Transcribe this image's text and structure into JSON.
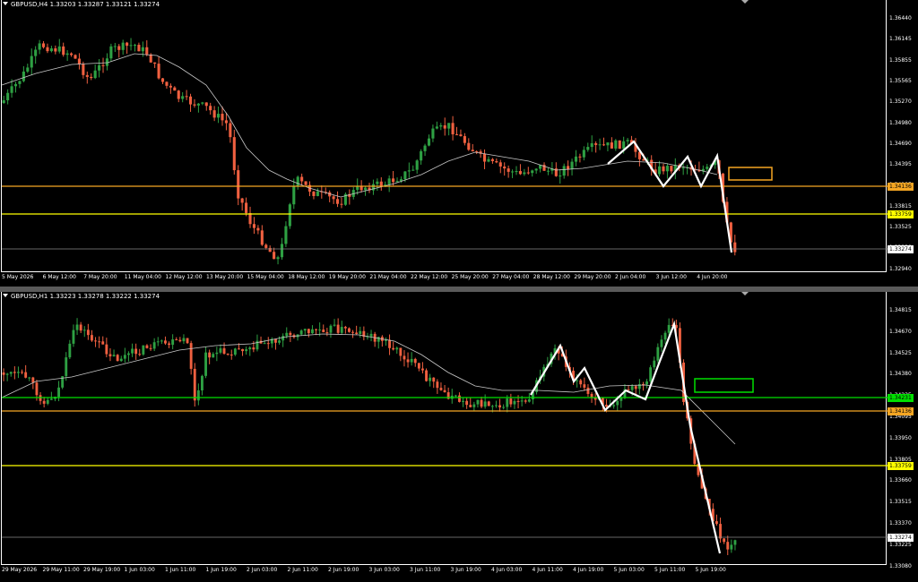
{
  "colors": {
    "background": "#000000",
    "bull": "#2ea043",
    "bear": "#f06040",
    "ma": "#c8c8c8",
    "orange_level": "#f5a623",
    "yellow_level": "#ffff00",
    "green_level": "#00e000",
    "pattern": "#ffffff"
  },
  "top_chart": {
    "title": "GBPUSD,H4  1.33203 1.33287 1.33121 1.33274",
    "price_ticks": [
      "1.36440",
      "1.36145",
      "1.35855",
      "1.35565",
      "1.35270",
      "1.34980",
      "1.34690",
      "1.34395",
      "1.34105",
      "1.33815",
      "1.33525",
      "1.33230",
      "1.32940"
    ],
    "time_ticks": [
      "5 May 2026",
      "6 May 12:00",
      "7 May 20:00",
      "11 May 04:00",
      "12 May 12:00",
      "13 May 20:00",
      "15 May 04:00",
      "18 May 12:00",
      "19 May 20:00",
      "21 May 04:00",
      "22 May 12:00",
      "25 May 20:00",
      "27 May 04:00",
      "28 May 12:00",
      "29 May 20:00",
      "2 Jun 04:00",
      "3 Jun 12:00",
      "4 Jun 20:00"
    ],
    "levels": {
      "orange": "1.34136",
      "yellow": "1.33759",
      "current": "1.33274"
    }
  },
  "bottom_chart": {
    "title": "GBPUSD,H1  1.33223 1.33278 1.33222 1.33274",
    "price_ticks": [
      "1.34815",
      "1.34670",
      "1.34525",
      "1.34380",
      "1.34235",
      "1.34095",
      "1.33950",
      "1.33805",
      "1.33660",
      "1.33515",
      "1.33370",
      "1.33225",
      "1.33080"
    ],
    "time_ticks": [
      "29 May 2026",
      "29 May 11:00",
      "29 May 19:00",
      "1 Jun 03:00",
      "1 Jun 11:00",
      "1 Jun 19:00",
      "2 Jun 03:00",
      "2 Jun 11:00",
      "2 Jun 19:00",
      "3 Jun 03:00",
      "3 Jun 11:00",
      "3 Jun 19:00",
      "4 Jun 03:00",
      "4 Jun 11:00",
      "4 Jun 19:00",
      "5 Jun 03:00",
      "5 Jun 11:00",
      "5 Jun 19:00"
    ],
    "levels": {
      "green": "1.34231",
      "orange": "1.34136",
      "yellow": "1.33759",
      "current": "1.33274"
    }
  }
}
